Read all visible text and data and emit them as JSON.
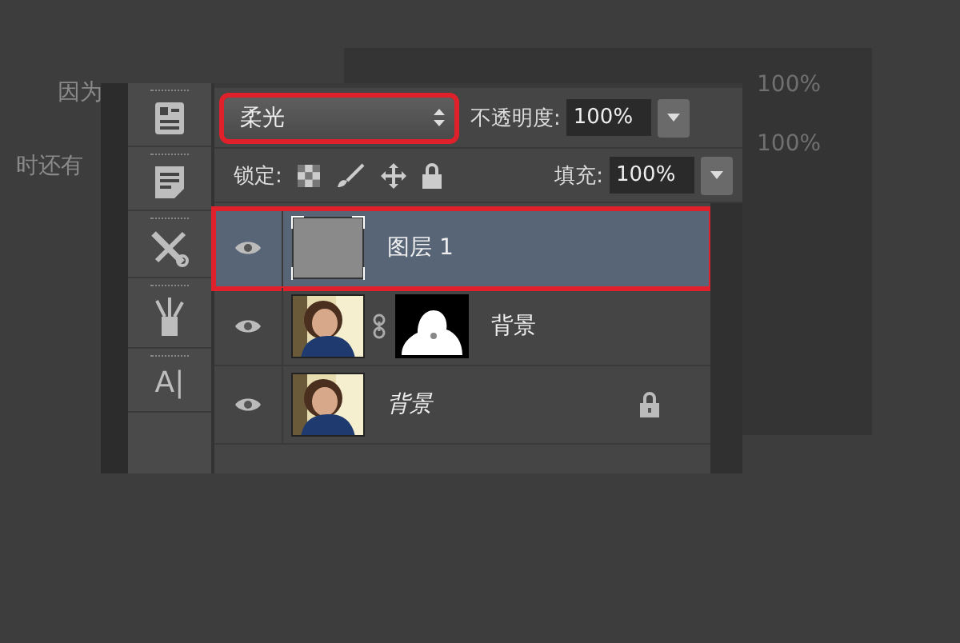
{
  "background_text": [
    "因为",
    "时还有"
  ],
  "background_panel": {
    "values": [
      "100%",
      "100%"
    ]
  },
  "tools": [
    {
      "kind": "panel"
    },
    {
      "kind": "notes"
    },
    {
      "kind": "tools"
    },
    {
      "kind": "brushes"
    },
    {
      "kind": "character",
      "label": "A|"
    }
  ],
  "layers_panel": {
    "blend_mode": {
      "value": "柔光",
      "annotated": true
    },
    "opacity": {
      "label": "不透明度:",
      "value": "100%"
    },
    "lock": {
      "label": "锁定:"
    },
    "fill": {
      "label": "填充:",
      "value": "100%"
    },
    "layers": [
      {
        "kind": "plain",
        "name": "图层 1",
        "visible": true,
        "selected": true,
        "annotated": true,
        "italic": false,
        "locked": false
      },
      {
        "kind": "masked",
        "name": "背景",
        "visible": true,
        "selected": false,
        "annotated": false,
        "italic": false,
        "locked": false
      },
      {
        "name": "背景",
        "visible": true,
        "selected": false,
        "annotated": false,
        "italic": true,
        "locked": true
      }
    ]
  }
}
